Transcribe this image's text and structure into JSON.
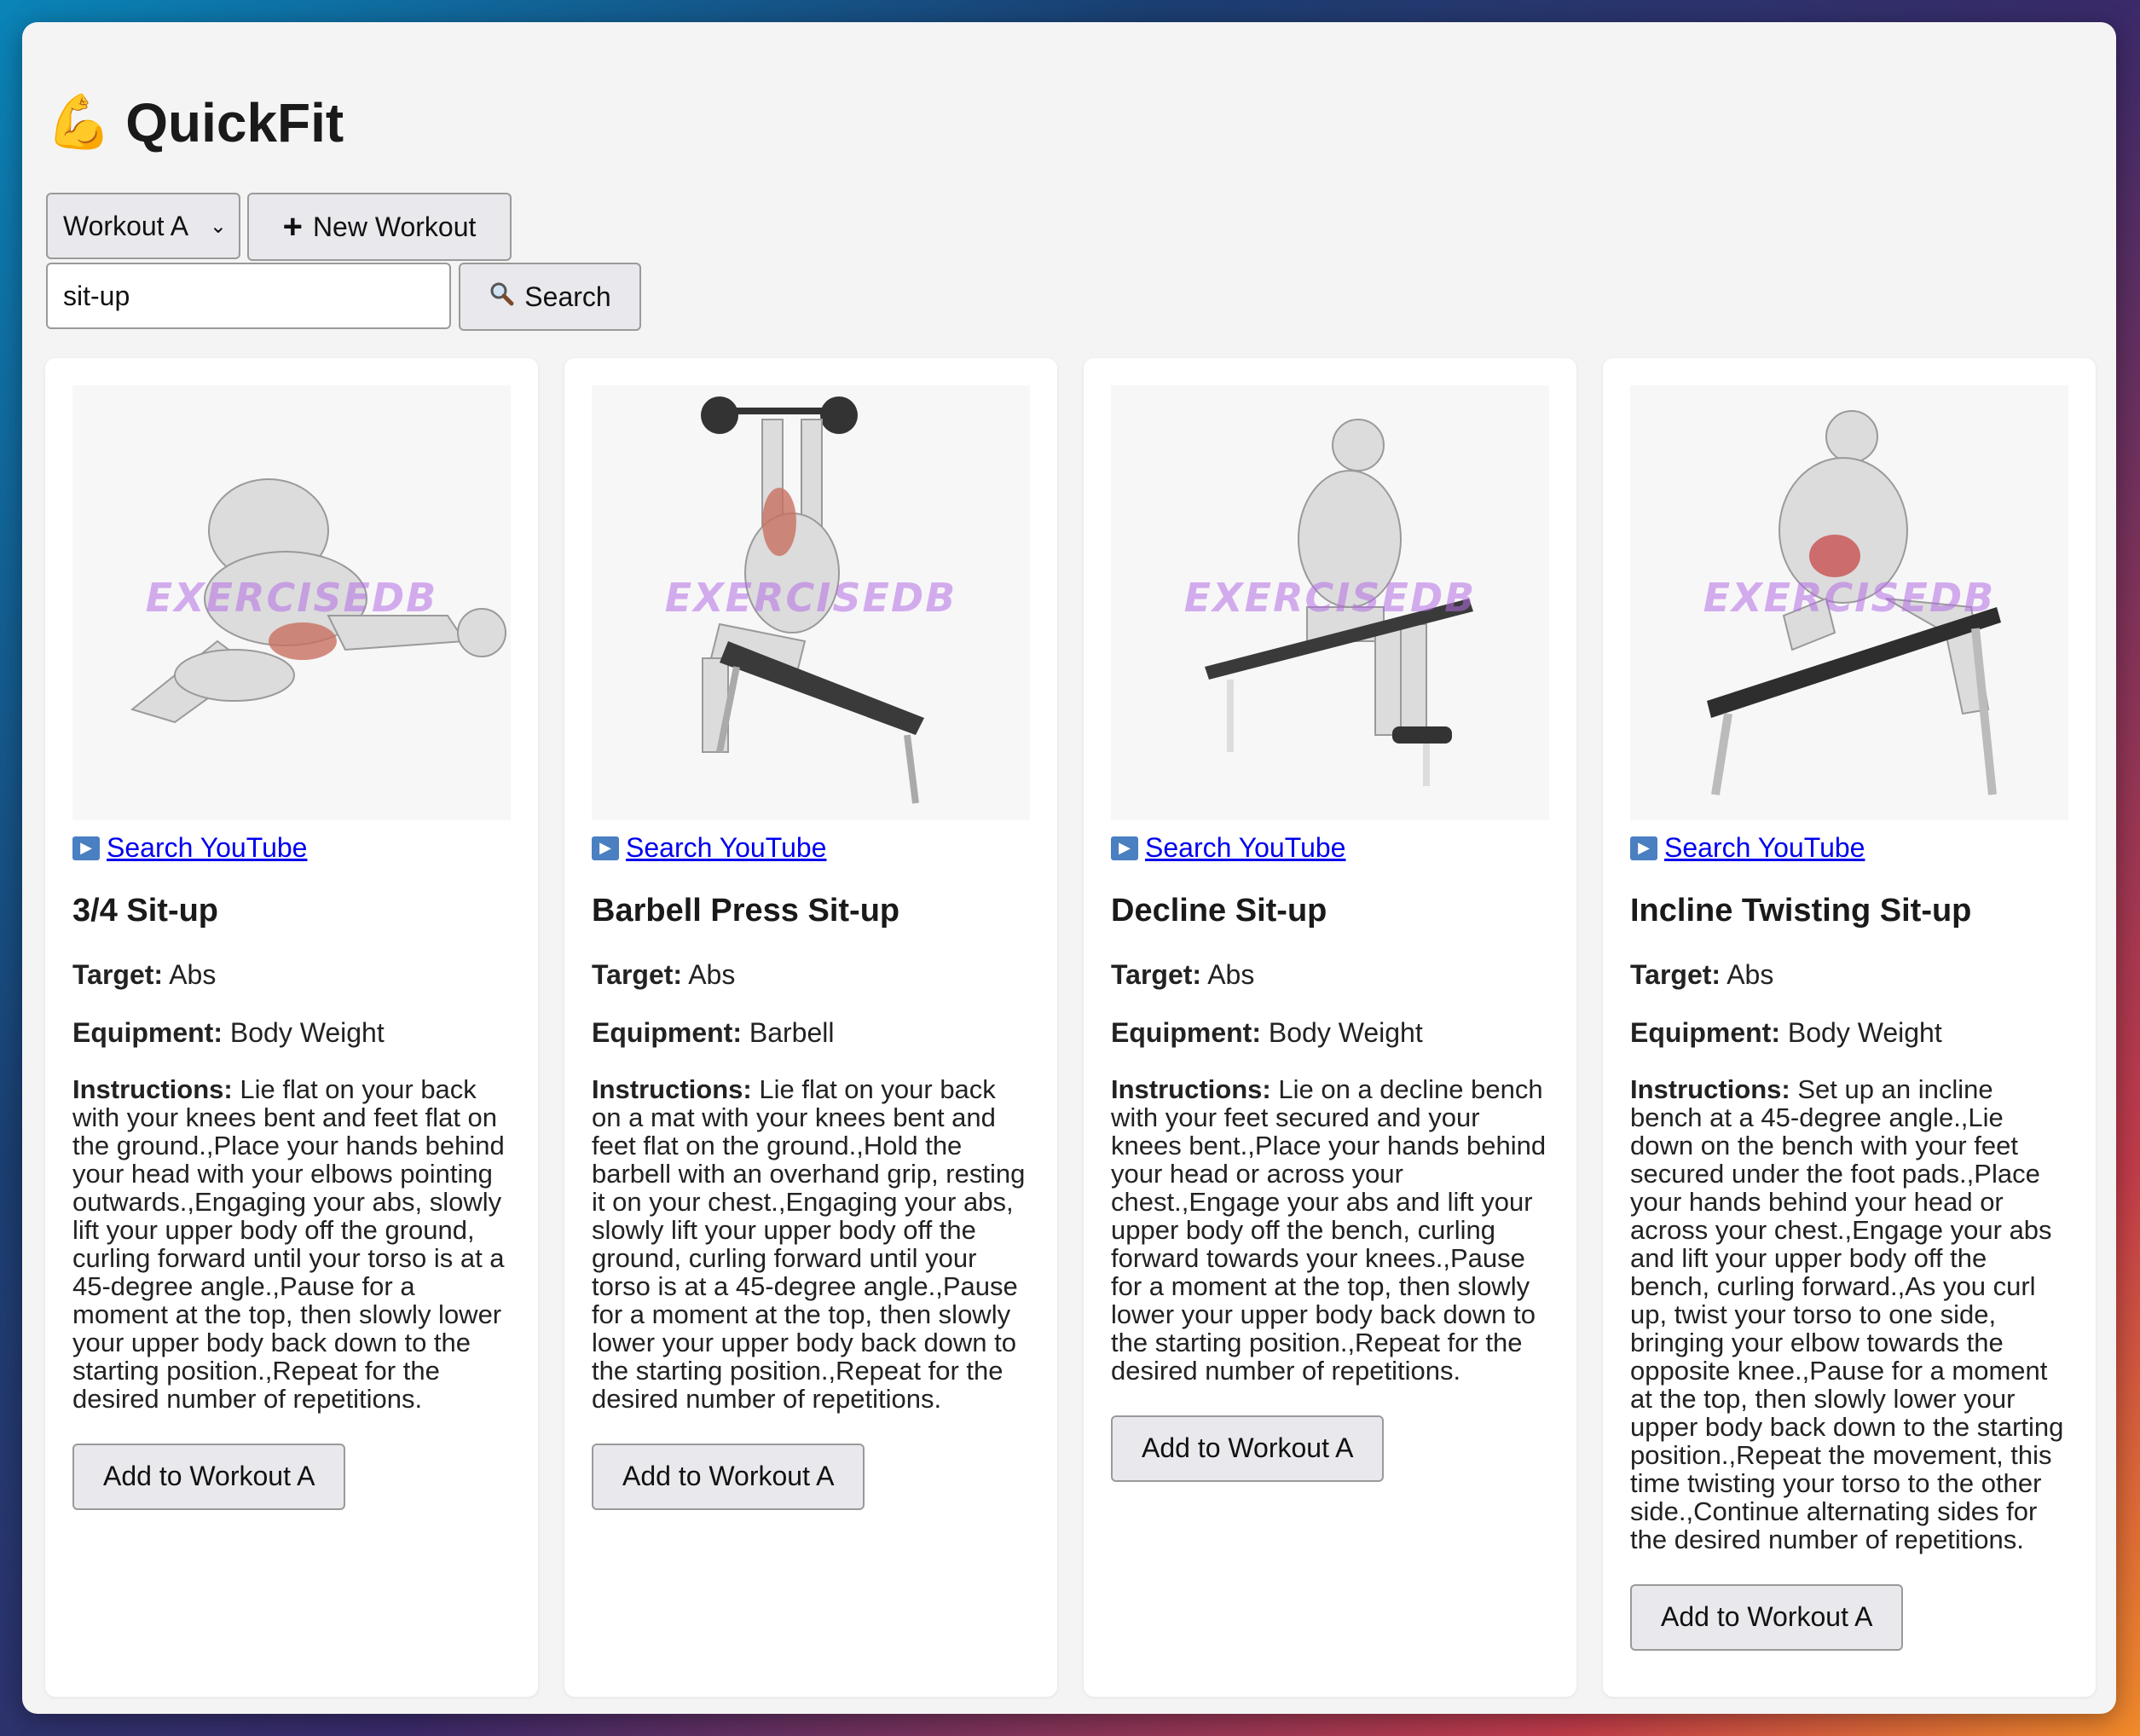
{
  "app": {
    "emoji": "💪",
    "title": "QuickFit"
  },
  "controls": {
    "workout_select": "Workout A",
    "new_workout_label": "New Workout",
    "search_value": "sit-up",
    "search_label": "Search"
  },
  "watermark": "EXERCISEDB",
  "youtube_label": "Search YouTube",
  "labels": {
    "target": "Target:",
    "equipment": "Equipment:",
    "instructions": "Instructions:"
  },
  "exercises": [
    {
      "name": "3/4 Sit-up",
      "target": "Abs",
      "equipment": "Body Weight",
      "instructions": "Lie flat on your back with your knees bent and feet flat on the ground.,Place your hands behind your head with your elbows pointing outwards.,Engaging your abs, slowly lift your upper body off the ground, curling forward until your torso is at a 45-degree angle.,Pause for a moment at the top, then slowly lower your upper body back down to the starting position.,Repeat for the desired number of repetitions.",
      "add_label": "Add to Workout A"
    },
    {
      "name": "Barbell Press Sit-up",
      "target": "Abs",
      "equipment": "Barbell",
      "instructions": "Lie flat on your back on a mat with your knees bent and feet flat on the ground.,Hold the barbell with an overhand grip, resting it on your chest.,Engaging your abs, slowly lift your upper body off the ground, curling forward until your torso is at a 45-degree angle.,Pause for a moment at the top, then slowly lower your upper body back down to the starting position.,Repeat for the desired number of repetitions.",
      "add_label": "Add to Workout A"
    },
    {
      "name": "Decline Sit-up",
      "target": "Abs",
      "equipment": "Body Weight",
      "instructions": "Lie on a decline bench with your feet secured and your knees bent.,Place your hands behind your head or across your chest.,Engage your abs and lift your upper body off the bench, curling forward towards your knees.,Pause for a moment at the top, then slowly lower your upper body back down to the starting position.,Repeat for the desired number of repetitions.",
      "add_label": "Add to Workout A"
    },
    {
      "name": "Incline Twisting Sit-up",
      "target": "Abs",
      "equipment": "Body Weight",
      "instructions": "Set up an incline bench at a 45-degree angle.,Lie down on the bench with your feet secured under the foot pads.,Place your hands behind your head or across your chest.,Engage your abs and lift your upper body off the bench, curling forward.,As you curl up, twist your torso to one side, bringing your elbow towards the opposite knee.,Pause for a moment at the top, then slowly lower your upper body back down to the starting position.,Repeat the movement, this time twisting your torso to the other side.,Continue alternating sides for the desired number of repetitions.",
      "add_label": "Add to Workout A"
    }
  ]
}
